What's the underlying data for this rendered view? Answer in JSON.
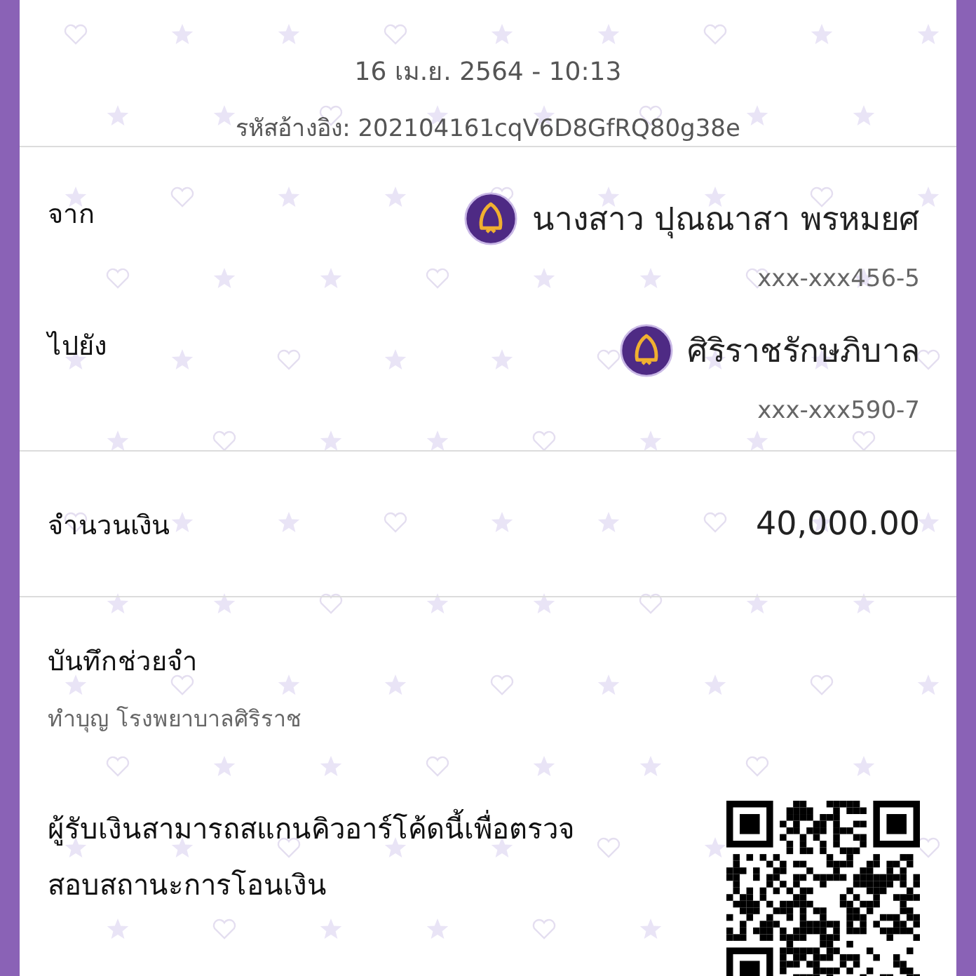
{
  "header": {
    "datetime": "16 เม.ย. 2564 - 10:13",
    "reference": "รหัสอ้างอิง: 202104161cqV6D8GfRQ80g38e"
  },
  "parties": [
    {
      "label": "จาก",
      "name": "นางสาว ปุณณาสา พรหมยศ",
      "account": "xxx-xxx456-5"
    },
    {
      "label": "ไปยัง",
      "name": "ศิริราชรักษภิบาล",
      "account": "xxx-xxx590-7"
    }
  ],
  "amount": {
    "label": "จำนวนเงิน",
    "value": "40,000.00"
  },
  "memo": {
    "label": "บันทึกช่วยจำ",
    "text": "ทำบุญ โรงพยาบาลศิริราช"
  },
  "verify": {
    "text": "ผู้รับเงินสามารถสแกนคิวอาร์โค้ดนี้เพื่อตรวจสอบสถานะการโอนเงิน"
  }
}
